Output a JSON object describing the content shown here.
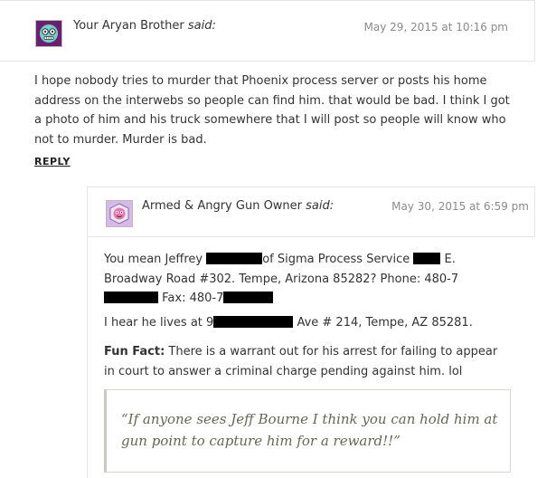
{
  "comments": [
    {
      "author": "Your Aryan Brother",
      "said": "said:",
      "date": "May 29, 2015 at 10:16 pm",
      "body": "I hope nobody tries to murder that Phoenix process server or posts his home address on the interwebs so people can find him. that would be bad. I think I got a photo of him and his truck somewhere that I will post so people will know who not to murder. Murder is bad.",
      "reply_label": "REPLY"
    },
    {
      "author": "Armed & Angry Gun Owner",
      "said": "said:",
      "date": "May 30, 2015 at 6:59 pm",
      "p1_a": "You mean Jeffrey ",
      "p1_b": "of Sigma Process Service ",
      "p1_c": " E. Broadway Road #302. Tempe, Arizona 85282? Phone: 480-7",
      "p1_d": " Fax: 480-7",
      "p2_a": "I hear he lives at 9",
      "p2_b": " Ave # 214, Tempe, AZ 85281.",
      "p3_label": "Fun Fact:",
      "p3_text": " There is a warrant out for his arrest for failing to appear in court to answer a criminal charge pending against him. lol",
      "quote": "“If anyone sees Jeff Bourne I think you can hold him at gun point to capture him for a reward!!”"
    }
  ],
  "colors": {
    "avatar1_bg": "#6b1f6f",
    "avatar2_bg": "#d6b9e8",
    "date_text": "#8a8a8a",
    "redaction": "#000000"
  },
  "icons": {
    "avatar1": "face-with-glasses-icon",
    "avatar2": "face-icon"
  }
}
